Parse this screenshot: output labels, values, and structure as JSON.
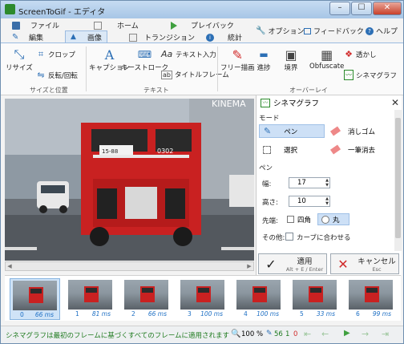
{
  "window": {
    "title": "ScreenToGif - エディタ",
    "min": "–",
    "max": "☐",
    "close": "✕"
  },
  "tabs": {
    "row1": [
      {
        "label": "ファイル",
        "icon": "save-icon"
      },
      {
        "label": "ホーム",
        "icon": "home-icon"
      },
      {
        "label": "プレイバック",
        "icon": "play-icon"
      }
    ],
    "row2": [
      {
        "label": "編集",
        "icon": "pencil-icon"
      },
      {
        "label": "画像",
        "icon": "image-icon"
      },
      {
        "label": "トランジション",
        "icon": "transition-icon"
      },
      {
        "label": "統計",
        "icon": "info-icon"
      }
    ],
    "right": {
      "options": "オプション",
      "feedback": "フィードバック",
      "help": "ヘルプ"
    }
  },
  "ribbon": {
    "size_group": {
      "resize": "リサイズ",
      "crop": "クロップ",
      "flip": "反転/回転",
      "caption": "サイズと位置"
    },
    "text_group": {
      "caption_btn": "キャプション",
      "keystroke": "キーストローク",
      "text_input": "テキスト入力",
      "title_frame": "タイトルフレーム",
      "caption": "テキスト"
    },
    "overlay_group": {
      "freedraw": "フリー描画",
      "progress": "進捗",
      "border": "境界",
      "obfuscate": "Obfuscate",
      "watermark": "透かし",
      "cinemagraph": "シネマグラフ",
      "caption": "オーバーレイ"
    }
  },
  "canvas": {
    "watermark": "KINEMA",
    "plate": "15-88",
    "truck_number": "0302"
  },
  "panel": {
    "title": "シネマグラフ",
    "mode_section": "モード",
    "pen": "ペン",
    "eraser": "消しゴム",
    "select": "選択",
    "clear": "一筆消去",
    "pen_section": "ペン",
    "width_label": "幅:",
    "width_value": "17",
    "height_label": "高さ:",
    "height_value": "10",
    "tip_label": "先端:",
    "tip_square": "四角",
    "tip_round": "丸",
    "other_label": "その他:",
    "fit_curve": "カーブに合わせる",
    "apply": "適用",
    "apply_shortcut": "Alt + E / Enter",
    "cancel": "キャンセル",
    "cancel_shortcut": "Esc"
  },
  "frames": [
    {
      "n": "0",
      "ms": "66 ms"
    },
    {
      "n": "1",
      "ms": "81 ms"
    },
    {
      "n": "2",
      "ms": "66 ms"
    },
    {
      "n": "3",
      "ms": "100 ms"
    },
    {
      "n": "4",
      "ms": "100 ms"
    },
    {
      "n": "5",
      "ms": "33 ms"
    },
    {
      "n": "6",
      "ms": "99 ms"
    }
  ],
  "status": {
    "message": "シネマグラフは最初のフレームに基づくすべてのフレームに適用されます",
    "zoom": "100",
    "zoom_unit": "%",
    "frame_count": "56",
    "selected_count": "1",
    "current": "0"
  },
  "colors": {
    "accent": "#2c6fb5",
    "truck": "#c92121",
    "status_text": "#1f7a1f"
  }
}
